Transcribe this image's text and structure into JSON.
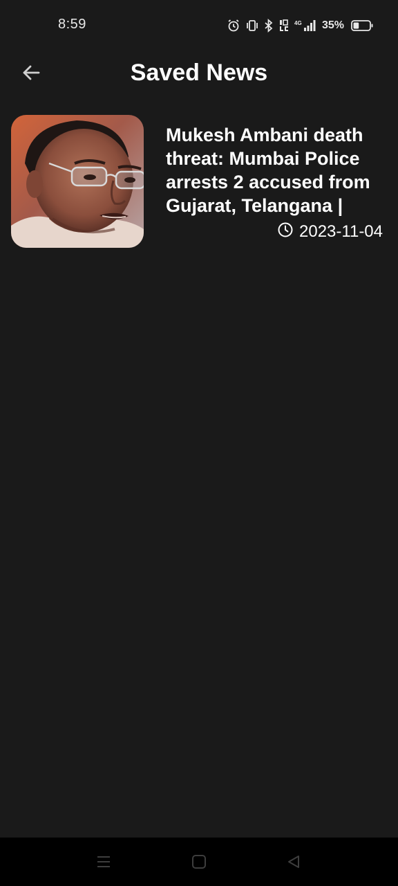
{
  "status_bar": {
    "time": "8:59",
    "battery_percent": "35%",
    "battery_level": 0.35,
    "icons": [
      "alarm-icon",
      "vibrate-icon",
      "bluetooth-icon",
      "volte-icon",
      "signal-4g-icon",
      "battery-icon"
    ]
  },
  "app_bar": {
    "title": "Saved News",
    "back_icon": "arrow-back-icon"
  },
  "news": [
    {
      "title": "Mukesh Ambani death threat: Mumbai Police arrests 2 accused from Gujarat, Telangana |",
      "date": "2023-11-04",
      "date_icon": "clock-icon"
    }
  ],
  "nav_bar": {
    "icons": [
      "menu-icon",
      "home-icon",
      "back-triangle-icon"
    ]
  },
  "colors": {
    "background": "#1a1a1a",
    "nav_background": "#000000",
    "text": "#ffffff"
  }
}
